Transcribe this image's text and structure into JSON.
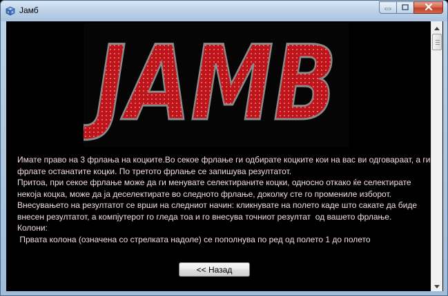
{
  "window": {
    "title": "Јамб",
    "app_icon": "dice-icon",
    "buttons": [
      "minimize-icon",
      "maximize-icon",
      "close-icon"
    ]
  },
  "logo": {
    "text": "JAMB",
    "color": "#c0141b",
    "outline": "#8a8a8a"
  },
  "instructions": {
    "paragraphs": [
      "Имате право на 3 фрлања на коцките.Во секое фрлање ги одбирате коцките кои на вас ви одговараат, а ги фрлате останатите коцки. По третото фрлање се запишува резултатот.",
      "Притоа, при секое фрлање може да ги менувате селектираните коцки, односно откако ќе селектирате некоја коцка, може да ја деселектирате во следното фрлање, доколку сте го промениле изборот.",
      "Внесувањето на резултатот се врши на следниот начин: кликнувате на полето каде што сакате да биде внесен резултатот, а компјутерот го гледа тоа и го внесува точниот резултат  од вашето фрлање.",
      "Колони:",
      " Првата колона (означена со стрелката надоле) се пополнува по ред од полето 1 до полето"
    ],
    "text_color": "#f3dede"
  },
  "back_button": {
    "label": "<< Назад"
  },
  "scrollbar": {
    "up_icon": "arrow-up-icon",
    "down_icon": "arrow-down-icon"
  }
}
